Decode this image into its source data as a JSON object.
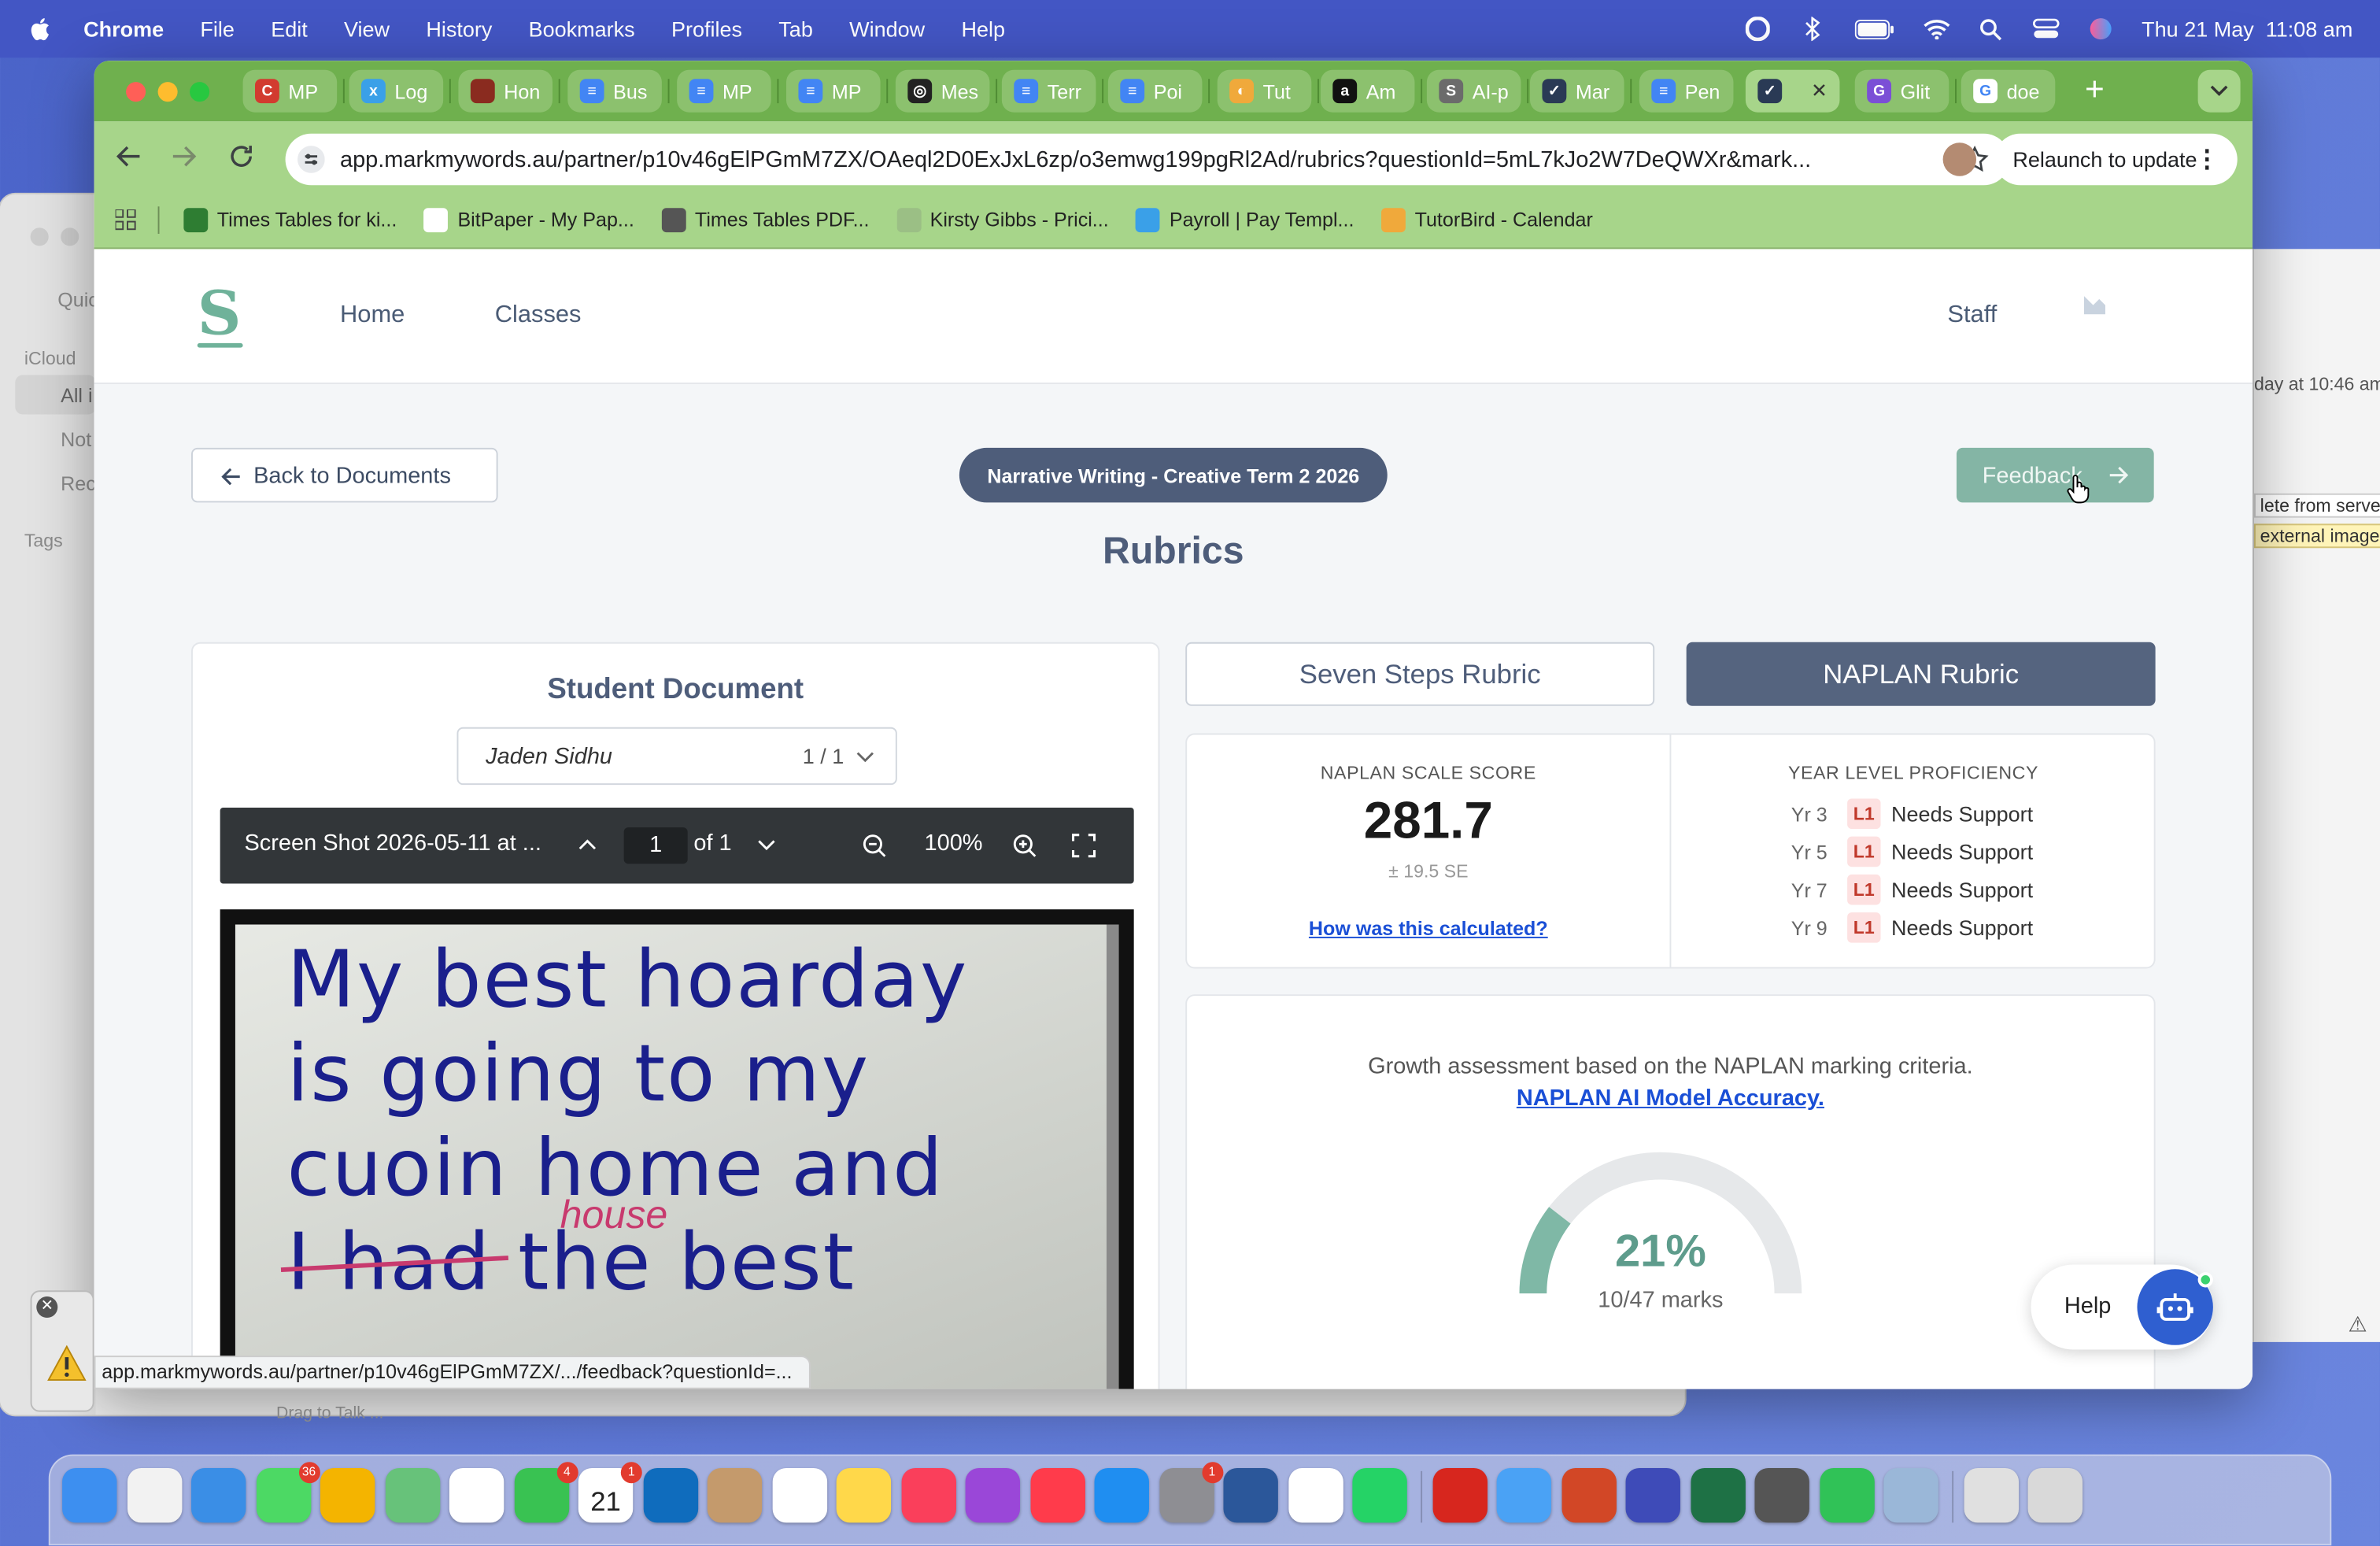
{
  "menubar": {
    "app": "Chrome",
    "items": [
      "File",
      "Edit",
      "View",
      "History",
      "Bookmarks",
      "Profiles",
      "Tab",
      "Window",
      "Help"
    ],
    "datetime": "Thu 21 May  11:08 am"
  },
  "bg_finder": {
    "quick": "Quic",
    "icloud": "iCloud",
    "all": "All i",
    "notes": "Not",
    "recent": "Rec",
    "tags": "Tags",
    "footer": "Drag to Talk ..."
  },
  "bg_right": {
    "date": "day at 10:46 am",
    "delete": "lete from server",
    "external": "external images"
  },
  "tabs": [
    {
      "label": "MP",
      "fav": "C",
      "color": "#d23b2f"
    },
    {
      "label": "Log",
      "fav": "x",
      "color": "#3aa0e8"
    },
    {
      "label": "Hon",
      "fav": "",
      "color": "#8a2b1f"
    },
    {
      "label": "Bus",
      "fav": "≡",
      "color": "#4285f4"
    },
    {
      "label": "MP",
      "fav": "≡",
      "color": "#4285f4"
    },
    {
      "label": "MP",
      "fav": "≡",
      "color": "#4285f4"
    },
    {
      "label": "Mes",
      "fav": "◎",
      "color": "#222222"
    },
    {
      "label": "Terr",
      "fav": "≡",
      "color": "#4285f4"
    },
    {
      "label": "Poi",
      "fav": "≡",
      "color": "#4285f4"
    },
    {
      "label": "Tut",
      "fav": "◐",
      "color": "#f0a93b"
    },
    {
      "label": "Am",
      "fav": "a",
      "color": "#111111"
    },
    {
      "label": "AI-p",
      "fav": "S",
      "color": "#6b6b6b"
    },
    {
      "label": "Mar",
      "fav": "✓",
      "color": "#2a3a55"
    },
    {
      "label": "Pen",
      "fav": "≡",
      "color": "#4285f4"
    },
    {
      "label": "",
      "fav": "✓",
      "color": "#2a3a55"
    },
    {
      "label": "Glit",
      "fav": "G",
      "color": "#7b4fd6"
    },
    {
      "label": "doe",
      "fav": "G",
      "color": "#ffffff"
    }
  ],
  "omnibox": {
    "url": "app.markmywords.au/partner/p10v46gElPGmM7ZX/OAeql2D0ExJxL6zp/o3emwg199pgRl2Ad/rubrics?questionId=5mL7kJo2W7DeQWXr&mark..."
  },
  "relaunch_label": "Relaunch to update",
  "bookmarks": [
    {
      "label": "Times Tables for ki...",
      "color": "#2e7d32"
    },
    {
      "label": "BitPaper - My Pap...",
      "color": "#ffffff"
    },
    {
      "label": "Times Tables PDF...",
      "color": "#555555"
    },
    {
      "label": "Kirsty Gibbs - Prici...",
      "color": "#9bbf85"
    },
    {
      "label": "Payroll | Pay Templ...",
      "color": "#3aa0e8"
    },
    {
      "label": "TutorBird - Calendar",
      "color": "#f0a93b"
    }
  ],
  "site": {
    "logo": "S",
    "nav": {
      "home": "Home",
      "classes": "Classes",
      "staff": "Staff"
    },
    "back_label": "Back to Documents",
    "assignment": "Narrative Writing - Creative Term 2 2026",
    "feedback_label": "Feedback",
    "page_title": "Rubrics"
  },
  "student_doc": {
    "title": "Student Document",
    "student": "Jaden Sidhu",
    "count": "1 / 1",
    "viewer": {
      "filename": "Screen Shot 2026-05-11 at ...",
      "page": "1",
      "of": "of 1",
      "zoom": "100%"
    },
    "handwriting": [
      "My best hoarday",
      "is going to my",
      "cuoin home and",
      "I had the best"
    ],
    "correction": "house"
  },
  "rubric_tabs": {
    "seven_steps": "Seven Steps Rubric",
    "naplan": "NAPLAN Rubric",
    "active": "naplan"
  },
  "naplan": {
    "score_label": "NAPLAN SCALE SCORE",
    "score": "281.7",
    "se": "± 19.5 SE",
    "calc_link": "How was this calculated?",
    "prof_label": "YEAR LEVEL PROFICIENCY",
    "proficiency": [
      {
        "year": "Yr 3",
        "level": "L1",
        "status": "Needs Support"
      },
      {
        "year": "Yr 5",
        "level": "L1",
        "status": "Needs Support"
      },
      {
        "year": "Yr 7",
        "level": "L1",
        "status": "Needs Support"
      },
      {
        "year": "Yr 9",
        "level": "L1",
        "status": "Needs Support"
      }
    ],
    "growth_text": "Growth assessment based on the NAPLAN marking criteria.",
    "accuracy_link": "NAPLAN AI Model Accuracy.",
    "percent": "21%",
    "percent_value": 0.21,
    "marks": "10/47 marks",
    "gauge_color": "#7fb8a6",
    "track_color": "#e6e8ea"
  },
  "help_label": "Help",
  "status_url": "app.markmywords.au/partner/p10v46gElPGmM7ZX/.../feedback?questionId=...",
  "dock": [
    {
      "name": "finder",
      "color": "#3d8ff0"
    },
    {
      "name": "launchpad",
      "color": "#f2f2f2"
    },
    {
      "name": "safari",
      "color": "#3a8ee6"
    },
    {
      "name": "messages",
      "color": "#4cd964",
      "badge": "36"
    },
    {
      "name": "chrome",
      "color": "#f4b400"
    },
    {
      "name": "maps",
      "color": "#67c27a"
    },
    {
      "name": "photos",
      "color": "#ffffff"
    },
    {
      "name": "facetime",
      "color": "#39c252",
      "badge": "4"
    },
    {
      "name": "calendar",
      "color": "#ffffff",
      "badge": "1",
      "text": "21"
    },
    {
      "name": "outlook",
      "color": "#0f6cbd"
    },
    {
      "name": "contacts",
      "color": "#c49a6c"
    },
    {
      "name": "reminders",
      "color": "#ffffff"
    },
    {
      "name": "notes",
      "color": "#ffd84a"
    },
    {
      "name": "music",
      "color": "#fa3f5b"
    },
    {
      "name": "podcasts",
      "color": "#9a47d8"
    },
    {
      "name": "news",
      "color": "#ff3b4b"
    },
    {
      "name": "app-store",
      "color": "#1f8ef1"
    },
    {
      "name": "system-settings",
      "color": "#8e8e93",
      "badge": "1"
    },
    {
      "name": "word",
      "color": "#2b579a"
    },
    {
      "name": "google-calendar",
      "color": "#ffffff"
    },
    {
      "name": "whatsapp",
      "color": "#25d366"
    },
    {
      "name": "acrobat",
      "color": "#d7261e"
    },
    {
      "name": "mail",
      "color": "#4aa2f5"
    },
    {
      "name": "powerpoint",
      "color": "#d24726"
    },
    {
      "name": "grammarly",
      "color": "#3e4bb8"
    },
    {
      "name": "excel",
      "color": "#1e7145"
    },
    {
      "name": "gimp",
      "color": "#555555"
    },
    {
      "name": "numbers",
      "color": "#30c257"
    },
    {
      "name": "preview",
      "color": "#9ab7d8"
    },
    {
      "name": "printer",
      "color": "#e0e0e0"
    },
    {
      "name": "trash",
      "color": "#d9d9d9"
    }
  ]
}
